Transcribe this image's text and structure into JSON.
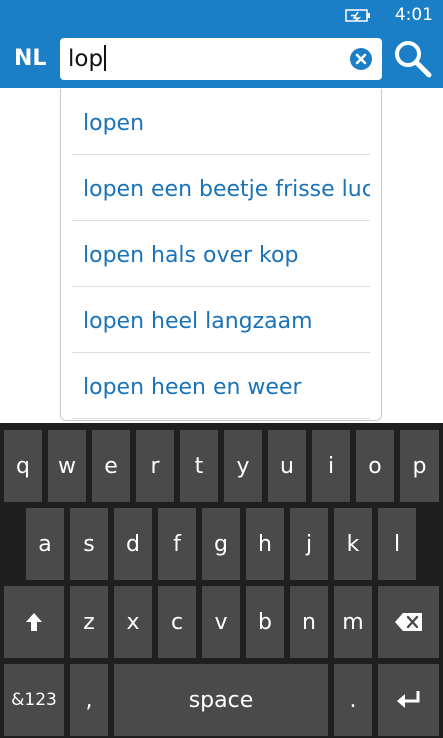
{
  "status_bar": {
    "time": "4:01"
  },
  "header": {
    "language": "NL",
    "search_value": "lop"
  },
  "suggestions": [
    "lopen",
    "lopen een beetje frisse lucht",
    "lopen hals over kop",
    "lopen heel langzaam",
    "lopen heen en weer"
  ],
  "keyboard": {
    "row1": [
      "q",
      "w",
      "e",
      "r",
      "t",
      "y",
      "u",
      "i",
      "o",
      "p"
    ],
    "row2": [
      "a",
      "s",
      "d",
      "f",
      "g",
      "h",
      "j",
      "k",
      "l"
    ],
    "row3": [
      "z",
      "x",
      "c",
      "v",
      "b",
      "n",
      "m"
    ],
    "numbers_label": "&123",
    "comma_label": ",",
    "space_label": "space",
    "period_label": "."
  },
  "colors": {
    "accent": "#1a7fc6",
    "suggestion_text": "#1a73b8",
    "key_bg": "#4a4a4a",
    "keyboard_bg": "#1f1f1f"
  }
}
